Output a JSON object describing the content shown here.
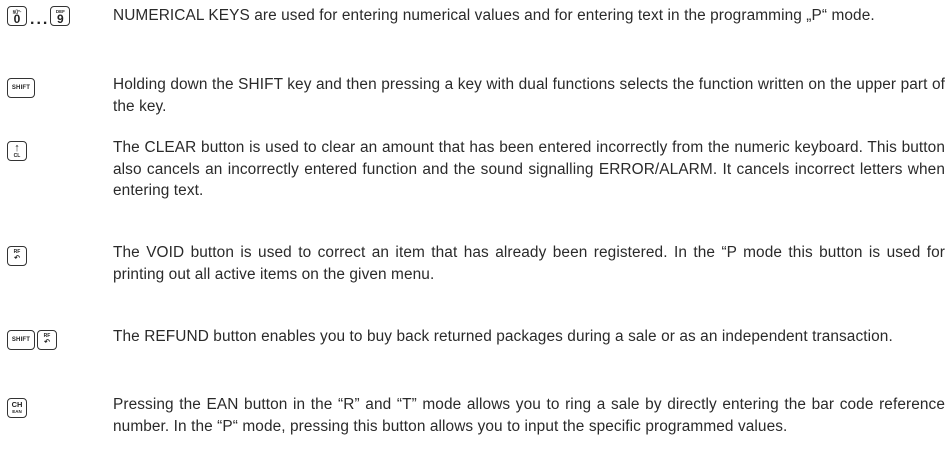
{
  "entries": [
    {
      "keys": [
        {
          "type": "numeric",
          "top": "§()*-",
          "main": "0"
        },
        {
          "type": "dots",
          "label": "..."
        },
        {
          "type": "numeric",
          "top": "DEF",
          "main": "9"
        }
      ],
      "text": "NUMERICAL KEYS are used for entering numerical values and for entering text in the programming „P“ mode."
    },
    {
      "keys": [
        {
          "type": "word",
          "label": "SHIFT"
        }
      ],
      "text": "Holding down the SHIFT key and then pressing a key with dual functions selects the function written on the upper part of the key."
    },
    {
      "keys": [
        {
          "type": "arrow-label",
          "symbol": "↑",
          "label": "CL"
        }
      ],
      "text": "The CLEAR button is used to clear an amount that has been entered incorrectly from the numeric keyboard. This button also cancels an incorrectly entered function and the sound signalling ERROR/ALARM. It cancels incorrect letters when entering text."
    },
    {
      "keys": [
        {
          "type": "label-arrow",
          "label": "RF",
          "symbol": "↶"
        }
      ],
      "text": "The VOID button is used to correct an item that has already been registered. In the “P mode this button is used for printing out all active items on the given menu."
    },
    {
      "keys": [
        {
          "type": "word",
          "label": "SHIFT"
        },
        {
          "type": "label-arrow",
          "label": "RF",
          "symbol": "↶"
        }
      ],
      "text": "The REFUND button enables you to buy back returned packages during a sale or as an independent transaction."
    },
    {
      "keys": [
        {
          "type": "two-label",
          "label": "CH",
          "sub": "EAN"
        }
      ],
      "text": "Pressing the EAN button in the “R” and “T” mode allows you to ring a sale by directly entering the bar code reference number. In the “P“ mode, pressing this button allows you to input the specific programmed values."
    }
  ]
}
